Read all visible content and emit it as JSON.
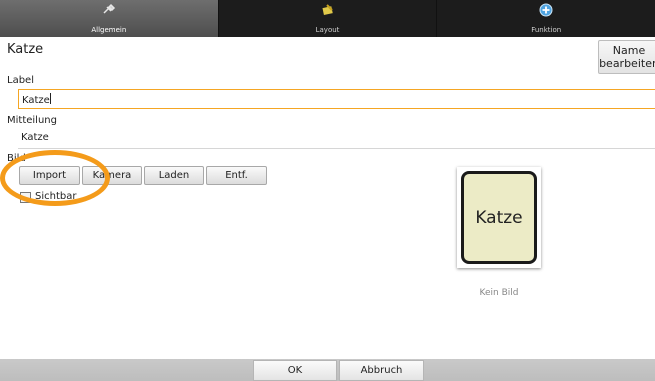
{
  "tabs": [
    {
      "label": "Allgemein",
      "icon": "general-settings-icon",
      "active": true
    },
    {
      "label": "Layout",
      "icon": "layout-icon",
      "active": false
    },
    {
      "label": "Funktion",
      "icon": "add-function-icon",
      "active": false
    }
  ],
  "header": {
    "title": "Katze",
    "rename_label": "Name\nbearbeiten"
  },
  "label_field": {
    "caption": "Label",
    "value": "Katze"
  },
  "message_field": {
    "caption": "Mitteilung",
    "value": "Katze"
  },
  "image_section": {
    "caption": "Bild",
    "buttons": [
      "Import",
      "Kamera",
      "Laden",
      "Entf."
    ],
    "visible_label": "Sichtbar",
    "preview_text": "Katze",
    "no_image_label": "Kein Bild"
  },
  "footer": {
    "ok_label": "OK",
    "cancel_label": "Abbruch"
  },
  "colors": {
    "focus_border": "#f5a623",
    "highlight_circle": "#f49b1a",
    "card_bg": "#ecebc6"
  }
}
